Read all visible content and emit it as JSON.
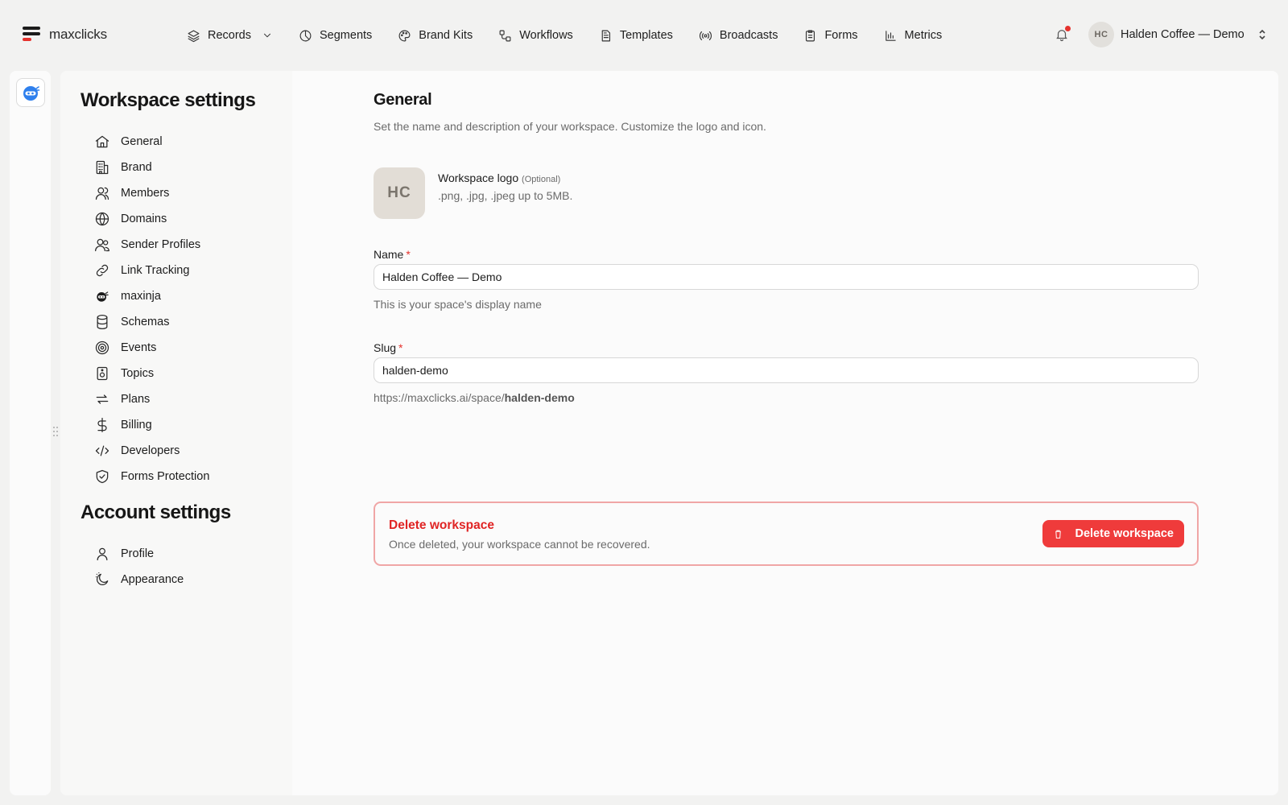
{
  "app": {
    "name": "maxclicks"
  },
  "nav": [
    {
      "label": "Records",
      "icon": "layers-icon"
    },
    {
      "label": "Segments",
      "icon": "pie-chart-icon"
    },
    {
      "label": "Brand Kits",
      "icon": "palette-icon"
    },
    {
      "label": "Workflows",
      "icon": "workflow-icon"
    },
    {
      "label": "Templates",
      "icon": "document-icon"
    },
    {
      "label": "Broadcasts",
      "icon": "broadcast-icon"
    },
    {
      "label": "Forms",
      "icon": "clipboard-icon"
    },
    {
      "label": "Metrics",
      "icon": "bar-chart-icon"
    }
  ],
  "account": {
    "initials": "HC",
    "name": "Halden Coffee — Demo"
  },
  "sidebar": {
    "workspace_title": "Workspace settings",
    "workspace_items": [
      {
        "label": "General",
        "icon": "home-icon"
      },
      {
        "label": "Brand",
        "icon": "building-icon"
      },
      {
        "label": "Members",
        "icon": "user-icon"
      },
      {
        "label": "Domains",
        "icon": "globe-icon"
      },
      {
        "label": "Sender Profiles",
        "icon": "users-icon"
      },
      {
        "label": "Link Tracking",
        "icon": "link-icon"
      },
      {
        "label": "maxinja",
        "icon": "ninja-icon"
      },
      {
        "label": "Schemas",
        "icon": "database-icon"
      },
      {
        "label": "Events",
        "icon": "target-icon"
      },
      {
        "label": "Topics",
        "icon": "speaker-icon"
      },
      {
        "label": "Plans",
        "icon": "repeat-icon"
      },
      {
        "label": "Billing",
        "icon": "dollar-icon"
      },
      {
        "label": "Developers",
        "icon": "code-icon"
      },
      {
        "label": "Forms Protection",
        "icon": "shield-check-icon"
      }
    ],
    "account_title": "Account settings",
    "account_items": [
      {
        "label": "Profile",
        "icon": "user-icon"
      },
      {
        "label": "Appearance",
        "icon": "moon-icon"
      }
    ]
  },
  "general": {
    "title": "General",
    "subtitle": "Set the name and description of your workspace. Customize the logo and icon.",
    "logo": {
      "initials": "HC",
      "label": "Workspace logo",
      "optional": "(Optional)",
      "hint": ".png, .jpg, .jpeg up to 5MB."
    },
    "name_field": {
      "label": "Name",
      "required": "*",
      "value": "Halden Coffee — Demo",
      "help": "This is your space's display name"
    },
    "slug_field": {
      "label": "Slug",
      "required": "*",
      "value": "halden-demo",
      "url_prefix": "https://maxclicks.ai/space/",
      "url_slug": "halden-demo"
    }
  },
  "danger": {
    "title": "Delete workspace",
    "subtitle": "Once deleted, your workspace cannot be recovered.",
    "button": "Delete workspace"
  },
  "colors": {
    "danger": "#ef3b3b",
    "logo_red": "#e5322d",
    "rail_icon": "#2f80ed"
  }
}
